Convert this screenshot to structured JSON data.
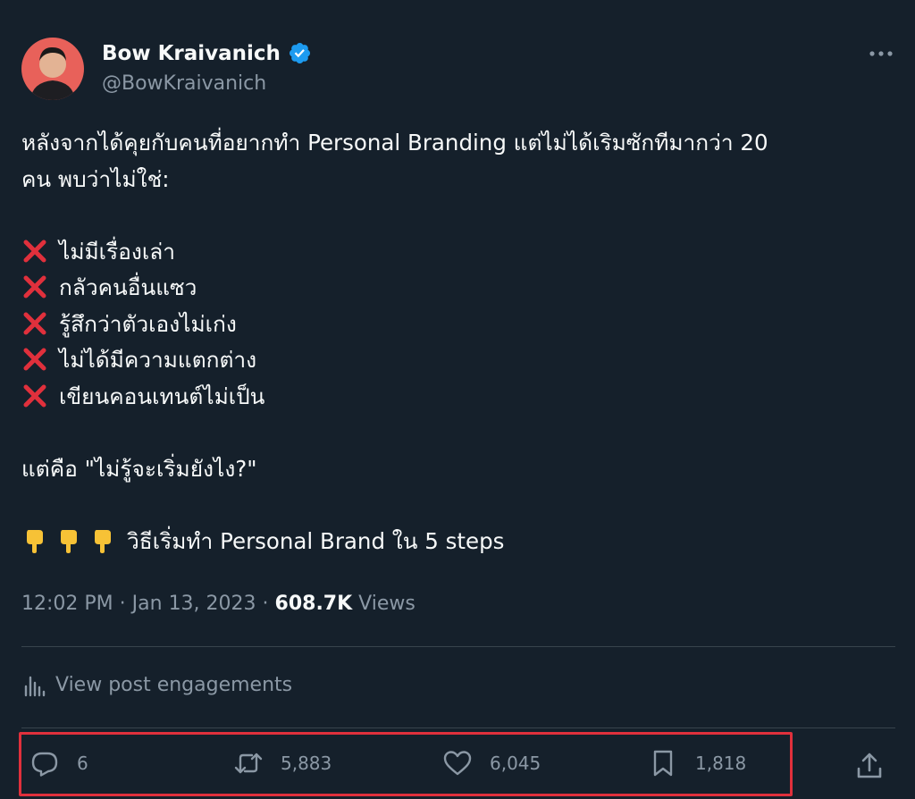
{
  "author": {
    "name": "Bow Kraivanich",
    "handle": "@BowKraivanich",
    "verified": true
  },
  "tweet": {
    "intro_line1": "หลังจากได้คุยกับคนที่อยากทำ Personal Branding แต่ไม่ได้เริมซักทีมากว่า 20",
    "intro_line2": "คน พบว่าไม่ใช่:",
    "reasons": [
      "ไม่มีเรื่องเล่า",
      "กลัวคนอื่นแซว",
      "รู้สึกว่าตัวเองไม่เก่ง",
      "ไม่ได้มีความแตกต่าง",
      "เขียนคอนเทนต์ไม่เป็น"
    ],
    "but_line": "แต่คือ \"ไม่รู้จะเริ่มยังไง?\"",
    "steps_line": "วิธีเริ่มทำ Personal Brand ใน 5 steps"
  },
  "meta": {
    "time": "12:02 PM",
    "separator": "·",
    "date": "Jan 13, 2023",
    "views_count": "608.7K",
    "views_label": "Views"
  },
  "engagements_label": "View post engagements",
  "actions": {
    "replies": "6",
    "reposts": "5,883",
    "likes": "6,045",
    "bookmarks": "1,818"
  },
  "colors": {
    "background": "#15202b",
    "text": "#f7f9f9",
    "secondary": "#8b98a5",
    "divider": "#38444d",
    "verified": "#1d9bf0",
    "highlight_box": "#e0303c"
  }
}
